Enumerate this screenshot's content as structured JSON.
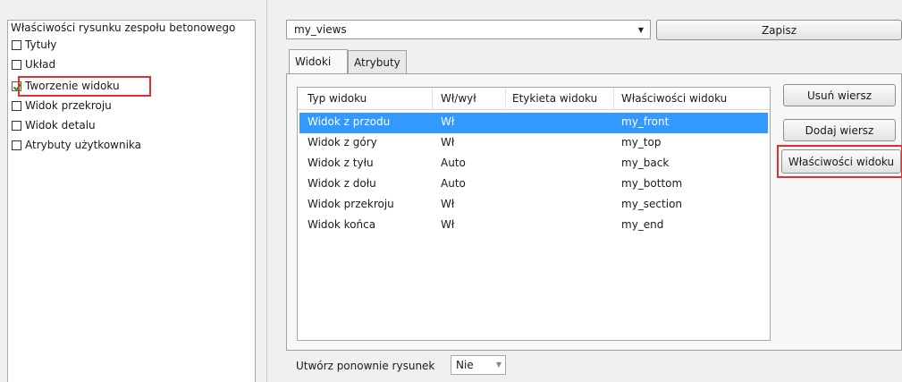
{
  "tree": {
    "root": "Właściwości rysunku zespołu betonowego",
    "items": [
      {
        "label": "Tytuły",
        "checked": false
      },
      {
        "label": "Układ",
        "checked": false
      },
      {
        "label": "Tworzenie widoku",
        "checked": true
      },
      {
        "label": "Widok przekroju",
        "checked": false
      },
      {
        "label": "Widok detalu",
        "checked": false
      },
      {
        "label": "Atrybuty użytkownika",
        "checked": false
      }
    ]
  },
  "settings": {
    "selected": "my_views",
    "save_label": "Zapisz"
  },
  "tabs": [
    {
      "label": "Widoki",
      "active": true
    },
    {
      "label": "Atrybuty",
      "active": false
    }
  ],
  "table": {
    "columns": [
      "Typ widoku",
      "Wł/wył",
      "Etykieta widoku",
      "Właściwości widoku"
    ],
    "rows": [
      {
        "type": "Widok z przodu",
        "onoff": "Wł",
        "label": "",
        "props": "my_front",
        "selected": true
      },
      {
        "type": "Widok z góry",
        "onoff": "Wł",
        "label": "",
        "props": "my_top",
        "selected": false
      },
      {
        "type": "Widok z tyłu",
        "onoff": "Auto",
        "label": "",
        "props": "my_back",
        "selected": false
      },
      {
        "type": "Widok z dołu",
        "onoff": "Auto",
        "label": "",
        "props": "my_bottom",
        "selected": false
      },
      {
        "type": "Widok przekroju",
        "onoff": "Wł",
        "label": "",
        "props": "my_section",
        "selected": false
      },
      {
        "type": "Widok końca",
        "onoff": "Wł",
        "label": "",
        "props": "my_end",
        "selected": false
      }
    ]
  },
  "actions": {
    "delete_row": "Usuń wiersz",
    "add_row": "Dodaj wiersz",
    "view_properties": "Właściwości widoku"
  },
  "footer": {
    "recreate_label": "Utwórz ponownie rysunek",
    "recreate_value": "Nie"
  },
  "colors": {
    "selection": "#3399ff",
    "highlight": "#e03030",
    "check": "#1f9a1f"
  }
}
